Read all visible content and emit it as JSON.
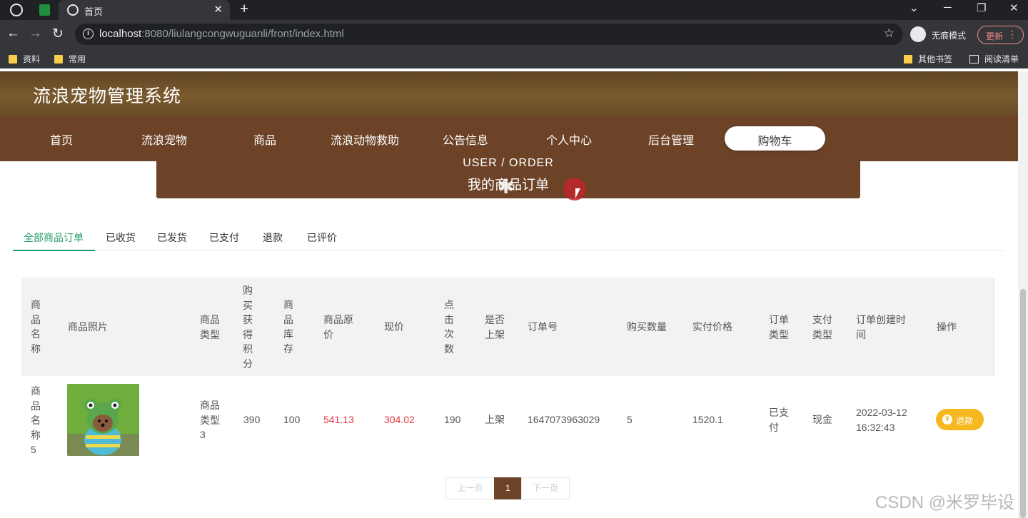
{
  "browser": {
    "tab_title": "首页",
    "url_host": "localhost",
    "url_rest": ":8080/liulangcongwuguanli/front/index.html",
    "incognito_label": "无痕模式",
    "update_label": "更新",
    "bookmarks": [
      "资料",
      "常用"
    ],
    "bookmarks_right": [
      "其他书签",
      "阅读清单"
    ]
  },
  "site": {
    "title": "流浪宠物管理系统",
    "nav": [
      "首页",
      "流浪宠物",
      "商品",
      "流浪动物救助",
      "公告信息",
      "个人中心",
      "后台管理",
      "购物车"
    ],
    "active_nav": "购物车",
    "banner_en": "USER / ORDER",
    "banner_cn": "我的商品订单"
  },
  "tabs": [
    "全部商品订单",
    "已收货",
    "已发货",
    "已支付",
    "退款",
    "已评价"
  ],
  "active_tab": "全部商品订单",
  "table": {
    "headers": {
      "name": "商品名称",
      "photo": "商品照片",
      "type": "商品类型",
      "points": "购买获得积分",
      "stock": "商品库存",
      "original_price": "商品原价",
      "price": "现价",
      "clicks": "点击次数",
      "on_shelf": "是否上架",
      "order_no": "订单号",
      "qty": "购买数量",
      "paid": "实付价格",
      "order_type": "订单类型",
      "pay_type": "支付类型",
      "created": "订单创建时间",
      "action": "操作"
    },
    "rows": [
      {
        "name": "商品名称5",
        "type": "商品类型3",
        "points": "390",
        "stock": "100",
        "original_price": "541.13",
        "price": "304.02",
        "clicks": "190",
        "on_shelf": "上架",
        "order_no": "1647073963029",
        "qty": "5",
        "paid": "1520.1",
        "order_type": "已支付",
        "pay_type": "现金",
        "created": "2022-03-12 16:32:43",
        "action": "退款"
      }
    ]
  },
  "pagination": {
    "prev": "上一页",
    "current": "1",
    "next": "下一页"
  },
  "watermark": "CSDN @米罗毕设"
}
